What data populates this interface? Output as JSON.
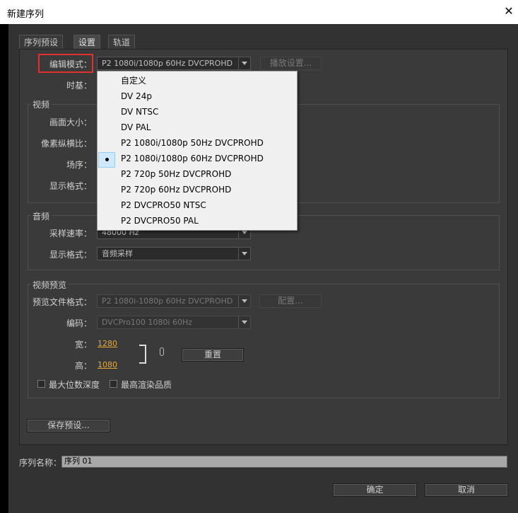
{
  "window": {
    "title": "新建序列"
  },
  "tabs": [
    {
      "label": "序列预设"
    },
    {
      "label": "设置"
    },
    {
      "label": "轨道"
    }
  ],
  "settings": {
    "edit_mode_label": "编辑模式：",
    "edit_mode_value": "P2 1080i/1080p 60Hz DVCPROHD",
    "playback_button": "播放设置...",
    "timebase_label": "时基："
  },
  "video": {
    "group_title": "视频",
    "frame_size_label": "画面大小：",
    "pixel_aspect_label": "像素纵横比：",
    "field_order_label": "场序：",
    "display_format_label": "显示格式："
  },
  "audio": {
    "group_title": "音频",
    "sample_rate_label": "采样速率：",
    "sample_rate_value": "48000 Hz",
    "display_format_label": "显示格式：",
    "display_format_value": "音频采样"
  },
  "preview": {
    "group_title": "视频预览",
    "file_format_label": "预览文件格式：",
    "file_format_value": "P2 1080i-1080p 60Hz DVCPROHD",
    "config_button": "配置...",
    "codec_label": "编码：",
    "codec_value": "DVCPro100 1080i 60Hz",
    "width_label": "宽：",
    "width_value": "1280",
    "height_label": "高：",
    "height_value": "1080",
    "reset_button": "重置",
    "max_bit_depth": "最大位数深度",
    "max_render_quality": "最高渲染品质"
  },
  "save_preset_button": "保存预设...",
  "sequence_name_label": "序列名称：",
  "sequence_name_value": "序列 01",
  "ok_button": "确定",
  "cancel_button": "取消",
  "dropdown": {
    "items": [
      "自定义",
      "DV 24p",
      "DV NTSC",
      "DV PAL",
      "P2 1080i/1080p 50Hz DVCPROHD",
      "P2 1080i/1080p 60Hz DVCPROHD",
      "P2 720p 50Hz DVCPROHD",
      "P2 720p 60Hz DVCPROHD",
      "P2 DVCPRO50 NTSC",
      "P2 DVCPRO50 PAL"
    ],
    "selected_index": 5
  },
  "colors": {
    "highlight": "#e03030",
    "accent_value": "#e6a935",
    "menu_selection": "#cde8ff"
  }
}
